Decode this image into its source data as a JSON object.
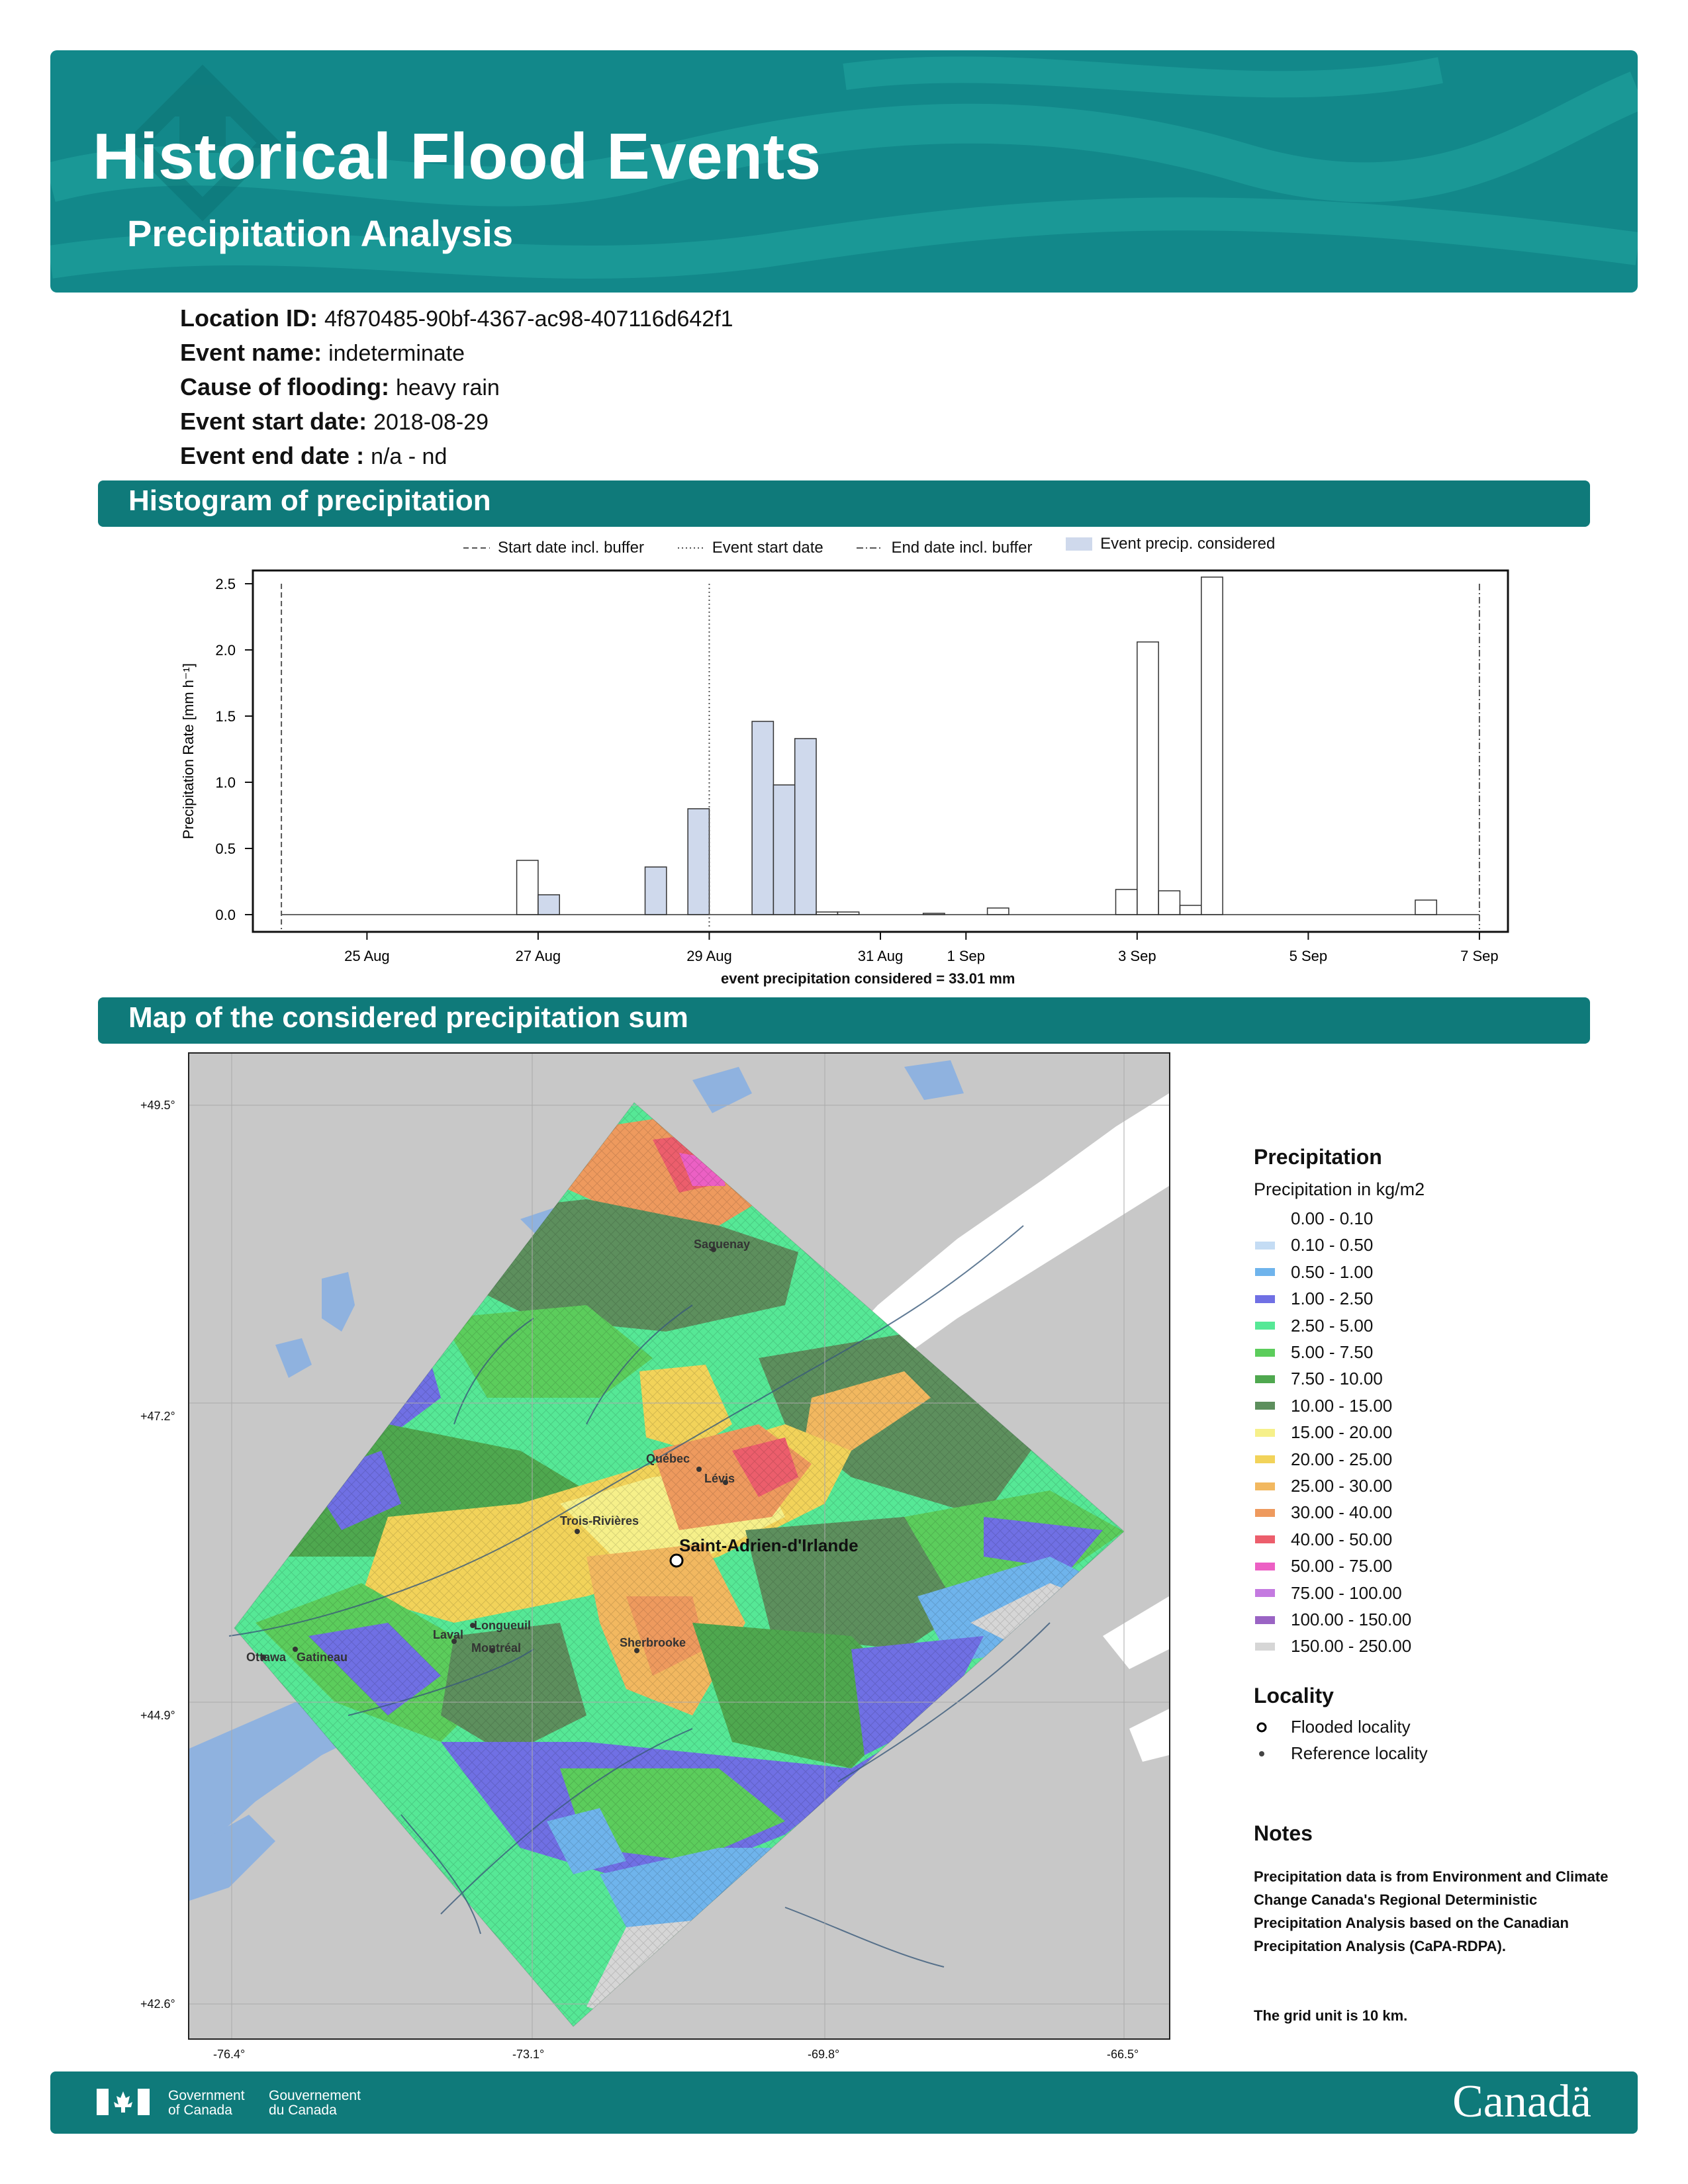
{
  "header": {
    "title": "Historical Flood Events",
    "subtitle": "Precipitation Analysis",
    "banner_color": "#12888a"
  },
  "event": {
    "location_id_label": "Location ID:",
    "location_id": "4f870485-90bf-4367-ac98-407116d642f1",
    "name_label": "Event name:",
    "name": "indeterminate",
    "cause_label": "Cause of flooding:",
    "cause": "heavy rain",
    "start_label": "Event start date:",
    "start": "2018-08-29",
    "end_label": "Event end date :",
    "end": "n/a - nd"
  },
  "histogram_section": {
    "title": "Histogram of precipitation",
    "legend": {
      "start_buffer": "Start date incl. buffer",
      "event_start": "Event start date",
      "end_buffer": "End date incl. buffer",
      "considered": "Event precip. considered"
    },
    "caption": "event precipitation considered = 33.01 mm"
  },
  "chart_data": {
    "type": "bar",
    "title": "",
    "xlabel": "",
    "ylabel": "Precipitation Rate [mm h⁻¹]",
    "ylim": [
      -0.13,
      2.6
    ],
    "xlim": [
      "2018-08-23T16:00",
      "2018-09-07T08:00"
    ],
    "yticks": [
      "0.0",
      "0.5",
      "1.0",
      "1.5",
      "2.0",
      "2.5"
    ],
    "xticks": [
      {
        "label": "25 Aug",
        "date": "2018-08-25"
      },
      {
        "label": "27 Aug",
        "date": "2018-08-27"
      },
      {
        "label": "29 Aug",
        "date": "2018-08-29"
      },
      {
        "label": "31 Aug",
        "date": "2018-08-31"
      },
      {
        "label": "1 Sep",
        "date": "2018-09-01"
      },
      {
        "label": "3 Sep",
        "date": "2018-09-03"
      },
      {
        "label": "5 Sep",
        "date": "2018-09-05"
      },
      {
        "label": "7 Sep",
        "date": "2018-09-07"
      }
    ],
    "bin_hours": 6,
    "start_buffer_date": "2018-08-24T00:00",
    "event_start_date": "2018-08-29T00:00",
    "end_buffer_date": "2018-09-07T00:00",
    "considered_color": "#cfd9ec",
    "bins": [
      {
        "start": "2018-08-26T18:00",
        "value": 0.41,
        "considered": false
      },
      {
        "start": "2018-08-27T00:00",
        "value": 0.15,
        "considered": true
      },
      {
        "start": "2018-08-28T06:00",
        "value": 0.36,
        "considered": true
      },
      {
        "start": "2018-08-28T18:00",
        "value": 0.8,
        "considered": true
      },
      {
        "start": "2018-08-29T12:00",
        "value": 1.46,
        "considered": true
      },
      {
        "start": "2018-08-29T18:00",
        "value": 0.98,
        "considered": true
      },
      {
        "start": "2018-08-30T00:00",
        "value": 1.33,
        "considered": true
      },
      {
        "start": "2018-08-30T06:00",
        "value": 0.02,
        "considered": false
      },
      {
        "start": "2018-08-30T12:00",
        "value": 0.02,
        "considered": false
      },
      {
        "start": "2018-08-31T12:00",
        "value": 0.01,
        "considered": false
      },
      {
        "start": "2018-09-01T06:00",
        "value": 0.05,
        "considered": false
      },
      {
        "start": "2018-09-02T18:00",
        "value": 0.19,
        "considered": false
      },
      {
        "start": "2018-09-03T00:00",
        "value": 2.06,
        "considered": false
      },
      {
        "start": "2018-09-03T06:00",
        "value": 0.18,
        "considered": false
      },
      {
        "start": "2018-09-03T12:00",
        "value": 0.07,
        "considered": false
      },
      {
        "start": "2018-09-03T18:00",
        "value": 2.55,
        "considered": false
      },
      {
        "start": "2018-09-06T06:00",
        "value": 0.11,
        "considered": false
      }
    ]
  },
  "map_section": {
    "title": "Map of the considered precipitation sum",
    "lat_labels": [
      "+49.5°",
      "+47.2°",
      "+44.9°",
      "+42.6°"
    ],
    "lon_labels": [
      "-76.4°",
      "-73.1°",
      "-69.8°",
      "-66.5°"
    ],
    "flooded_locality": "Saint-Adrien-d'Irlande",
    "reference_localities": [
      "Saguenay",
      "Québec",
      "Lévis",
      "Trois-Rivières",
      "Longueuil",
      "Laval",
      "Montréal",
      "Sherbrooke",
      "Ottawa",
      "Gatineau"
    ],
    "land_color": "#c8c8c8",
    "water_color": "#8fb2df"
  },
  "legend": {
    "precip_title": "Precipitation",
    "precip_subtitle": "Precipitation in kg/m2",
    "classes": [
      {
        "label": "0.00 - 0.10",
        "color": "#ffffff"
      },
      {
        "label": "0.10 - 0.50",
        "color": "#c4dcf4"
      },
      {
        "label": "0.50 - 1.00",
        "color": "#6fb4ec"
      },
      {
        "label": "1.00 - 2.50",
        "color": "#7070e4"
      },
      {
        "label": "2.50 - 5.00",
        "color": "#56e896"
      },
      {
        "label": "5.00 - 7.50",
        "color": "#5ccd5c"
      },
      {
        "label": "7.50 - 10.00",
        "color": "#4fa84f"
      },
      {
        "label": "10.00 - 15.00",
        "color": "#5d8f5d"
      },
      {
        "label": "15.00 - 20.00",
        "color": "#f6f08a"
      },
      {
        "label": "20.00 - 25.00",
        "color": "#f2d35a"
      },
      {
        "label": "25.00 - 30.00",
        "color": "#f2b860"
      },
      {
        "label": "30.00 - 40.00",
        "color": "#ee9a5e"
      },
      {
        "label": "40.00 - 50.00",
        "color": "#ec5e6c"
      },
      {
        "label": "50.00 - 75.00",
        "color": "#ec60c4"
      },
      {
        "label": "75.00 - 100.00",
        "color": "#c47ae0"
      },
      {
        "label": "100.00 - 150.00",
        "color": "#9a64c4"
      },
      {
        "label": "150.00 - 250.00",
        "color": "#d6d6d6"
      }
    ],
    "locality_title": "Locality",
    "flooded_label": "Flooded locality",
    "reference_label": "Reference locality",
    "notes_title": "Notes",
    "notes_text": "Precipitation data is from Environment and Climate Change Canada's Regional Deterministic Precipitation Analysis based on the Canadian Precipitation Analysis (CaPA-RDPA).",
    "notes_grid": "The grid unit is 10 km."
  },
  "footer": {
    "gov_en_1": "Government",
    "gov_en_2": "of Canada",
    "gov_fr_1": "Gouvernement",
    "gov_fr_2": "du Canada",
    "wordmark": "Canadä"
  }
}
